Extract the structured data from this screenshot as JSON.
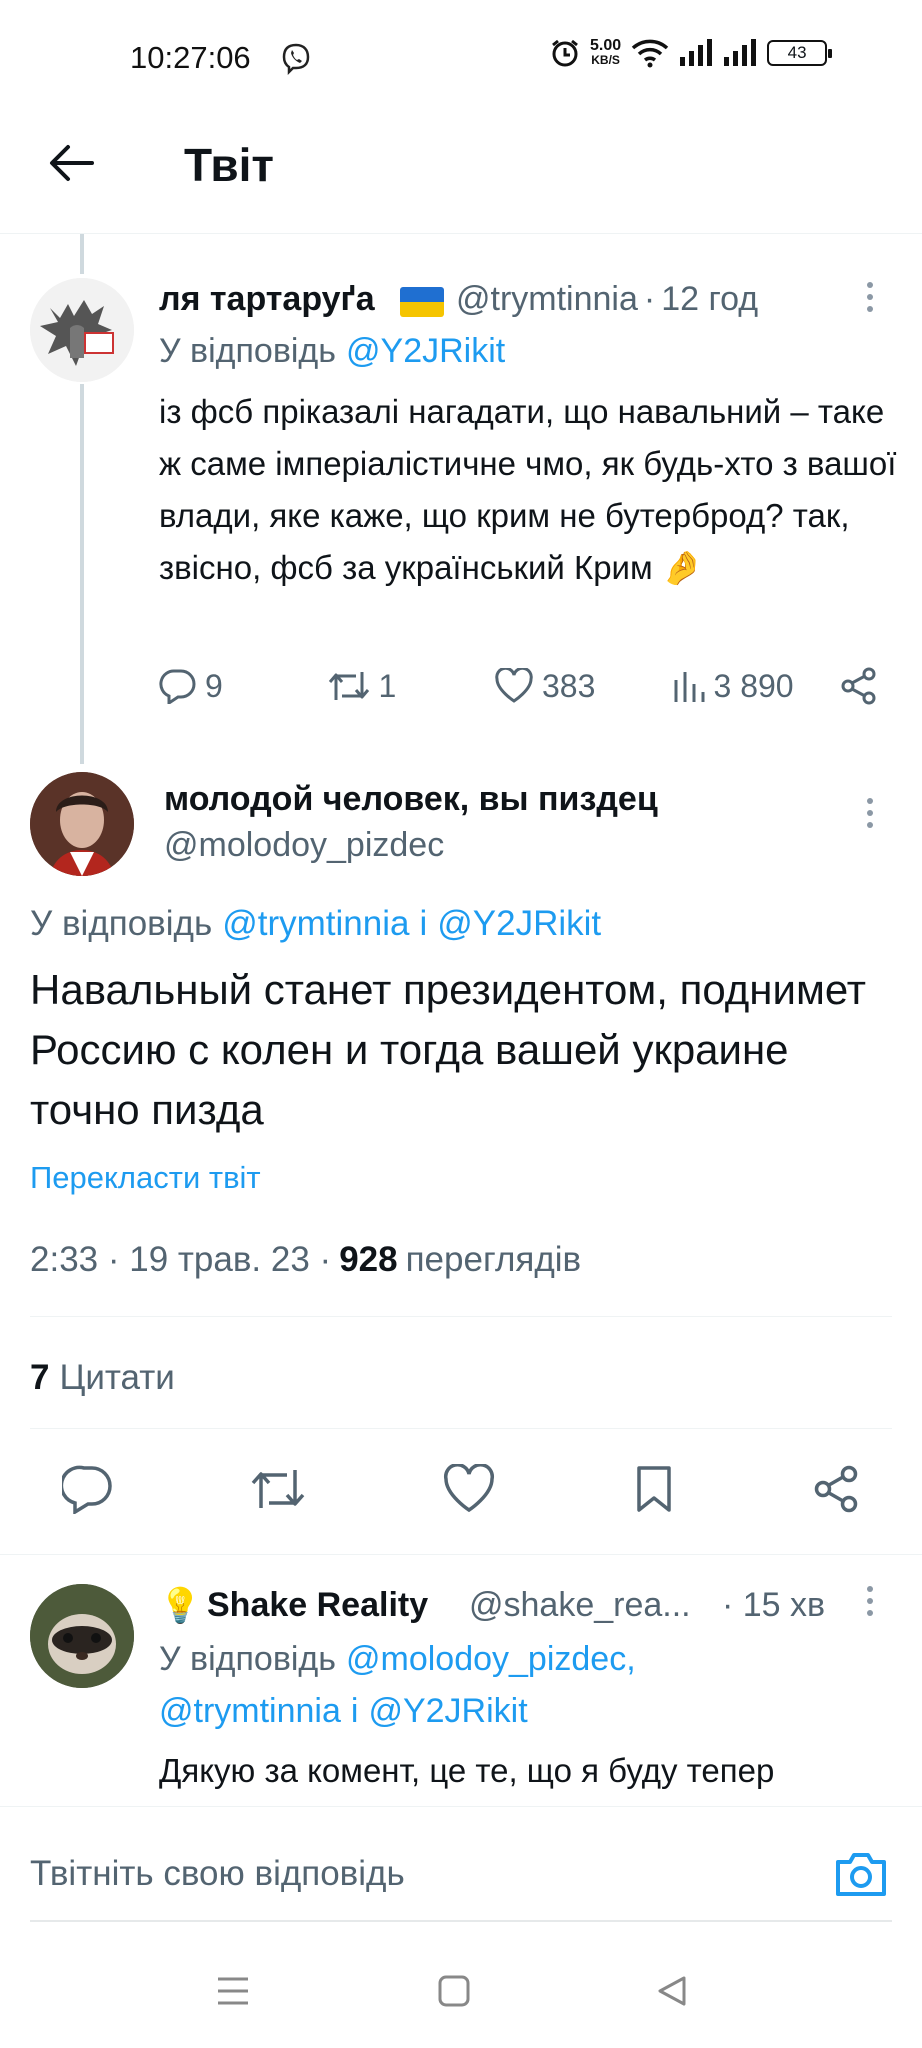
{
  "status_bar": {
    "time": "10:27:06",
    "net_speed": "5.00",
    "net_unit": "KB/S",
    "battery": "43"
  },
  "header": {
    "title": "Твіт"
  },
  "reply1": {
    "name": "ля тартаруґа",
    "handle": "@trymtinnia",
    "time": "12 год",
    "reply_label": "У відповідь",
    "reply_to": "@Y2JRikit",
    "text": "із фсб пріказалі нагадати, що навальний – таке ж саме імперіалістичне чмо, як будь-хто з вашої влади, яке каже, що крим не бутерброд? так, звісно, фсб за український Крим 🤌",
    "replies": "9",
    "retweets": "1",
    "likes": "383",
    "views": "3 890"
  },
  "main_tweet": {
    "name": "молодой человек, вы пиздец",
    "handle": "@molodoy_pizdec",
    "reply_label": "У відповідь",
    "reply_to_1": "@trymtinnia",
    "reply_conj": "і",
    "reply_to_2": "@Y2JRikit",
    "text": "Навальный станет президентом, поднимет Россию с колен и тогда вашей украине точно пизда",
    "translate": "Перекласти твіт",
    "time": "2:33 · 19 трав. 23 ·",
    "views_count": "928",
    "views_label": "переглядів",
    "quotes_count": "7",
    "quotes_label": "Цитати"
  },
  "reply2": {
    "emoji": "💡",
    "name": "Shake Reality",
    "handle": "@shake_rea...",
    "time": "· 15 хв",
    "reply_label": "У відповідь",
    "reply_to_1": "@molodoy_pizdec,",
    "reply_to_2": "@trymtinnia",
    "reply_conj": "і",
    "reply_to_3": "@Y2JRikit",
    "text": "Дякую за комент, це те, що я буду тепер"
  },
  "compose": {
    "placeholder": "Твітніть свою відповідь"
  },
  "colors": {
    "link": "#1d9bf0",
    "muted": "#536471",
    "text": "#0f1419"
  }
}
